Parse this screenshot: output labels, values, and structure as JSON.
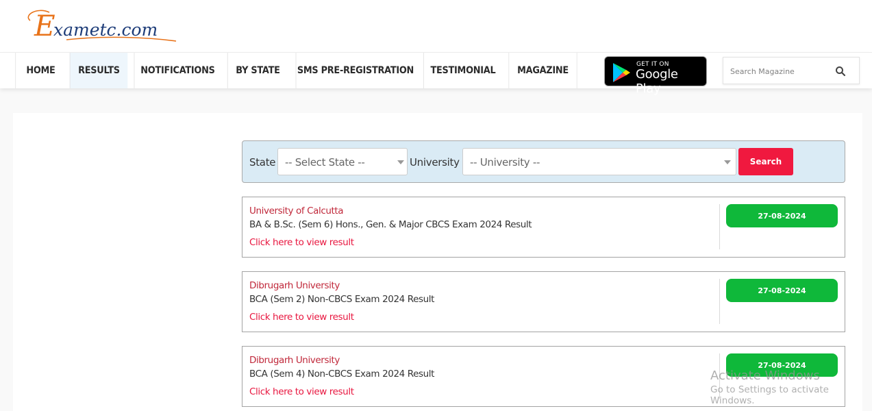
{
  "brand": {
    "logo_text_e": "E",
    "logo_text_rest": "xametc.com",
    "colors": {
      "logo_orange": "#e8731a",
      "logo_navy": "#1d3c78"
    }
  },
  "nav": {
    "items": [
      {
        "label": "HOME",
        "active": false
      },
      {
        "label": "RESULTS",
        "active": true
      },
      {
        "label": "NOTIFICATIONS",
        "active": false
      },
      {
        "label": "BY STATE",
        "active": false
      },
      {
        "label": "SMS PRE-REGISTRATION",
        "active": false
      },
      {
        "label": "TESTIMONIAL",
        "active": false
      },
      {
        "label": "MAGAZINE",
        "active": false
      }
    ]
  },
  "google_play": {
    "small": "GET IT ON",
    "big": "Google Play"
  },
  "search_magazine": {
    "placeholder": "Search Magazine",
    "value": "",
    "icon": "search-icon"
  },
  "filter": {
    "state_label": "State",
    "state_selected": "-- Select State --",
    "university_label": "University",
    "university_selected": "-- University --",
    "search_button": "Search",
    "colors": {
      "panel_bg": "#daebf5",
      "button_bg": "#f0193f"
    }
  },
  "results": [
    {
      "university": "University of Calcutta",
      "title": "BA & B.Sc. (Sem 6) Hons., Gen. & Major CBCS Exam 2024 Result",
      "link": "Click here to view result",
      "date": "27-08-2024"
    },
    {
      "university": "Dibrugarh University",
      "title": "BCA (Sem 2) Non-CBCS Exam 2024 Result",
      "link": "Click here to view result",
      "date": "27-08-2024"
    },
    {
      "university": "Dibrugarh University",
      "title": "BCA (Sem 4) Non-CBCS Exam 2024 Result",
      "link": "Click here to view result",
      "date": "27-08-2024"
    }
  ],
  "colors": {
    "date_badge": "#0fb83a",
    "university_text": "#c0283a",
    "link_text": "#e8163f"
  },
  "watermark": {
    "line1": "Activate Windows",
    "line2": "Go to Settings to activate Windows."
  }
}
